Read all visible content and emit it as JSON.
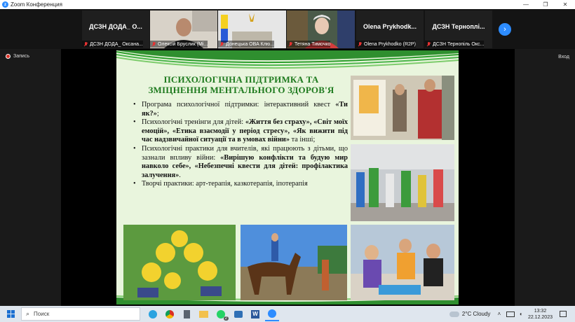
{
  "window": {
    "title": "Zoom Конференция",
    "minimize": "—",
    "maximize": "❐",
    "close": "✕"
  },
  "participants": [
    {
      "tile_name": "ДСЗН ДОДА_ О...",
      "caption": "ДСЗН ДОДА_ Оксана..."
    },
    {
      "tile_name": "",
      "caption": "Олексій Бруслик (Мі..."
    },
    {
      "tile_name": "",
      "caption": "Донецька ОВА Клю..."
    },
    {
      "tile_name": "",
      "caption": "Тетяна Тимочко"
    },
    {
      "tile_name": "Olena Prykhodk...",
      "caption": "Olena Prykhodko (R2P)"
    },
    {
      "tile_name": "ДСЗН Терноплі...",
      "caption": "ДСЗН Тернопіль Окс..."
    }
  ],
  "record_label": "Запись",
  "enter_label": "Вход",
  "slide": {
    "title_line1": "ПСИХОЛОГІЧНА ПІДТРИМКА ТА",
    "title_line2": "ЗМІЦНЕННЯ МЕНТАЛЬНОГО ЗДОРОВ'Я",
    "b1_a": "Програма психологічної підтримки: інтерактивний квест ",
    "b1_b": "«Ти як?»",
    "b1_c": ";",
    "b2_a": "Психологічні тренінги для дітей: ",
    "b2_b": "«Життя без страху», «Світ моїх емоцій», «Етика взаємодії у період стресу», «Як вижити під час надзвичайної ситуації та в умовах війни»",
    "b2_c": " та інші;",
    "b3_a": "Психологічні практики для вчителів, які працюють з дітьми, що зазнали впливу війни: ",
    "b3_b": "«Вирішую конфлікти та будую мир навколо себе», «Небезпечні квести для дітей: профілактика залучення»",
    "b3_c": ".",
    "b4": "Творчі практики: арт-терапія, казкотерапія, іпотерапія"
  },
  "taskbar": {
    "search_placeholder": "Поиск",
    "weather": "2°C  Cloudy",
    "time": "13:32",
    "date": "22.12.2023",
    "chat_badge": "2"
  }
}
